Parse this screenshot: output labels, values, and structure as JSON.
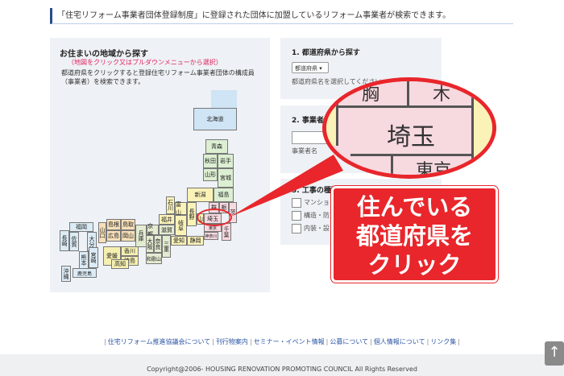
{
  "notice": "「住宅リフォーム事業者団体登録制度」に登録された団体に加盟しているリフォーム事業者が検索できます。",
  "left": {
    "title": "お住まいの地域から探す",
    "note": "（地図をクリック又はプルダウンメニューから選択）",
    "desc1": "都道府県をクリックすると登録住宅リフォーム事業者団体の構成員",
    "desc2": "（事業者）を検索できます。"
  },
  "map": {
    "hokkaido": "北海道",
    "aomori": "青森",
    "akita": "秋田",
    "iwate": "岩手",
    "yamagata": "山形",
    "miyagi": "宮城",
    "fukushima": "福島",
    "niigata": "新潟",
    "ishikawa": "石川",
    "toyama": "富山",
    "gunma": "群",
    "tochigi": "栃",
    "ibaraki": "茨",
    "nagano": "長野",
    "fukui": "福井",
    "gifu": "岐阜",
    "yamanashi": "山",
    "saitama": "埼玉",
    "tokyo": "東京",
    "chiba": "千葉",
    "kanagawa": "神奈川",
    "shizuoka": "静岡",
    "aichi": "愛知",
    "shiga": "滋賀",
    "kyoto": "京都",
    "mie": "三重",
    "nara": "奈良",
    "osaka": "大阪",
    "wakayama": "和歌山",
    "hyogo": "兵庫",
    "tottori": "鳥取",
    "shimane": "島根",
    "okayama": "岡山",
    "hiroshima": "広島",
    "yamaguchi": "山口",
    "kagawa": "香川",
    "tokushima": "徳島",
    "ehime": "愛媛",
    "kochi": "高知",
    "fukuoka": "福岡",
    "saga": "佐賀",
    "nagasaki": "長崎",
    "oita": "大分",
    "kumamoto": "熊本",
    "miyazaki": "宮崎",
    "kagoshima": "鹿児島",
    "okinawa": "沖縄"
  },
  "right": {
    "s1_title": "1. 都道府県から探す",
    "s1_select": "都道府県",
    "s1_hint": "都道府県名を選択してください",
    "s2_title": "2. 事業者",
    "s2_hint": "事業者名",
    "s3_title": "3. 工事の種類から探す",
    "s3_opts": [
      "マンショ",
      "構造・防",
      "内装・設"
    ]
  },
  "zoom": {
    "top1": "胸",
    "top2": "木",
    "main": "埼玉",
    "bottom": "東京"
  },
  "callout": {
    "line1": "住んでいる",
    "line2": "都道府県を",
    "line3": "クリック"
  },
  "footer": {
    "links": [
      "住宅リフォーム推進協議会について",
      "刊行物案内",
      "セミナー・イベント情報",
      "公募について",
      "個人情報について",
      "リンク集"
    ],
    "copyright": "Copyright@2006- HOUSING RENOVATION PROMOTING COUNCIL All Rights Reserved"
  },
  "colors": {
    "accent_red": "#e8262b",
    "navy": "#2a4d8a",
    "hokkaido": "#cfe4f5",
    "tohoku": "#dcefd2",
    "kanto": "#f7d9e0",
    "chubu": "#fbf2b8",
    "kinki": "#e3ecd1",
    "chugoku": "#f7dfb8",
    "shikoku": "#f6f0b0",
    "kyushu": "#dcecf6"
  },
  "icons": {
    "totop": "arrow-up-icon"
  }
}
